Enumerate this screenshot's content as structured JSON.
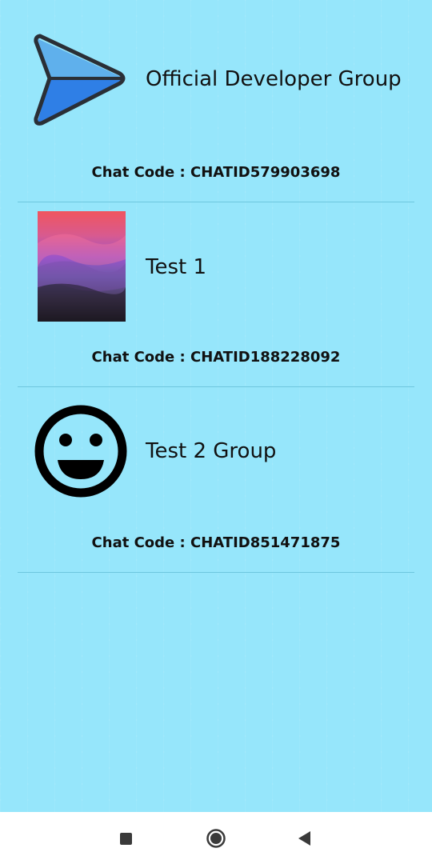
{
  "groups": [
    {
      "name": "Official Developer Group",
      "code_label": "Chat Code : CHATID579903698",
      "thumbnail_icon": "paper-plane-icon"
    },
    {
      "name": "Test 1",
      "code_label": "Chat Code : CHATID188228092",
      "thumbnail_icon": "gradient-photo"
    },
    {
      "name": "Test 2 Group",
      "code_label": "Chat Code : CHATID851471875",
      "thumbnail_icon": "smiley-face-icon"
    }
  ],
  "nav": {
    "recents_icon": "square-icon",
    "home_icon": "circle-icon",
    "back_icon": "back-triangle-icon"
  },
  "colors": {
    "background": "#96e6fb",
    "divider": "#6ec6de"
  }
}
